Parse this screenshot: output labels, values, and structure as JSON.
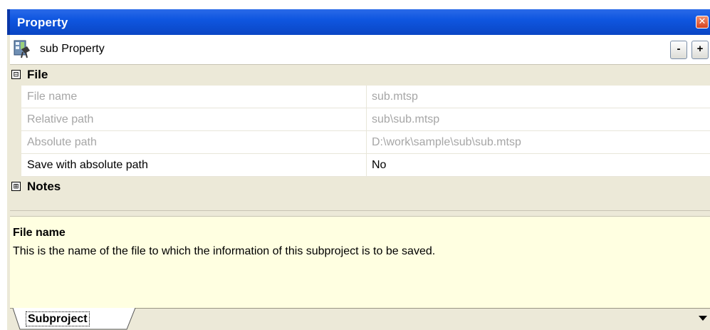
{
  "window": {
    "title": "Property",
    "close_icon": "close-icon"
  },
  "header": {
    "title": "sub Property",
    "icon": "subproject-property-icon",
    "collapse_label": "-",
    "expand_label": "+"
  },
  "categories": [
    {
      "label": "File",
      "toggle": "⊟",
      "expanded": true,
      "rows": [
        {
          "name": "File name",
          "value": "sub.mtsp",
          "readonly": true
        },
        {
          "name": "Relative path",
          "value": "sub\\sub.mtsp",
          "readonly": true
        },
        {
          "name": "Absolute path",
          "value": "D:\\work\\sample\\sub\\sub.mtsp",
          "readonly": true
        },
        {
          "name": "Save with absolute path",
          "value": "No",
          "readonly": false
        }
      ]
    },
    {
      "label": "Notes",
      "toggle": "⊞",
      "expanded": false,
      "rows": []
    }
  ],
  "description": {
    "title": "File name",
    "text": "This is the name of the file to which the information of this subproject is to be saved."
  },
  "tabs": [
    {
      "label": "Subproject",
      "active": true
    }
  ],
  "colors": {
    "titlebar": "#0f56e0",
    "panel": "#ece9d8",
    "description_bg": "#ffffe1",
    "readonly_text": "#a6a6a6"
  }
}
